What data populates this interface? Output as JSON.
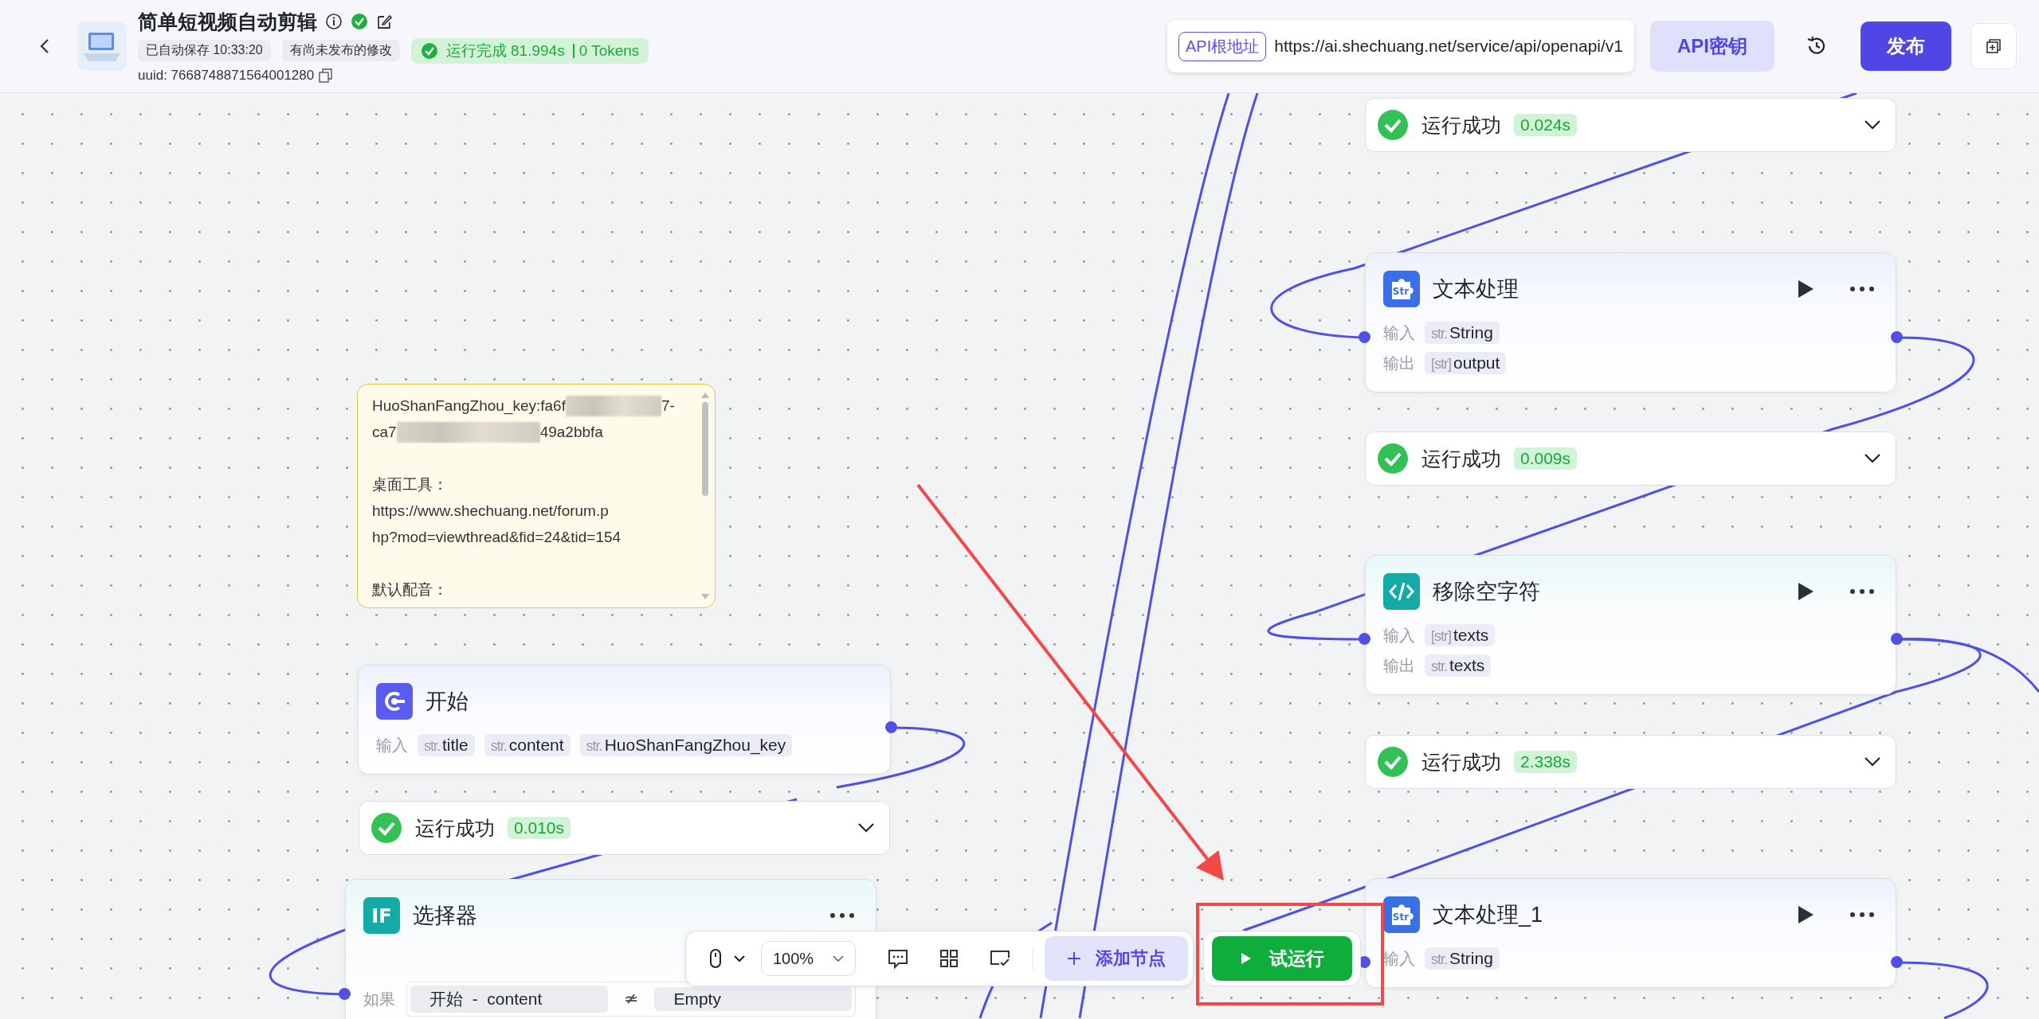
{
  "header": {
    "title": "简单短视频自动剪辑",
    "badges": [
      "已自动保存 10:33:20",
      "有尚未发布的修改"
    ],
    "run_status": {
      "text": "运行完成 81.994s",
      "tokens": "0 Tokens"
    },
    "uuid": "uuid: 7668748871564001280",
    "api_base": {
      "label": "API根地址",
      "url": "https://ai.shechuang.net/service/api/openapi/v1"
    },
    "api_key_button": "API密钥",
    "publish_button": "发布"
  },
  "canvas": {
    "note": {
      "paragraphs": [
        {
          "lines": [
            {
              "parts": [
                {
                  "kind": "text",
                  "text": "HuoShanFangZhou_key:fa6f"
                },
                {
                  "kind": "redacted"
                },
                {
                  "kind": "text",
                  "text": "7-"
                }
              ]
            },
            {
              "parts": [
                {
                  "kind": "text",
                  "text": "ca7"
                },
                {
                  "kind": "redacted"
                },
                {
                  "kind": "text",
                  "text": "49a2bbfa"
                }
              ]
            }
          ]
        },
        {
          "lines": [
            {
              "parts": [
                {
                  "kind": "text",
                  "text": "桌面工具："
                }
              ]
            },
            {
              "parts": [
                {
                  "kind": "text",
                  "text": "https://www.shechuang.net/forum.p"
                }
              ]
            },
            {
              "parts": [
                {
                  "kind": "text",
                  "text": "hp?mod=viewthread&fid=24&tid=154"
                }
              ]
            }
          ]
        },
        {
          "lines": [
            {
              "parts": [
                {
                  "kind": "text",
                  "text": "默认配音："
                }
              ]
            }
          ]
        }
      ]
    },
    "nodes": [
      {
        "kind": "start",
        "title": "开始",
        "rows": [
          {
            "label": "输入",
            "vars": [
              {
                "type": "str.",
                "name": "title"
              },
              {
                "type": "str.",
                "name": "content"
              },
              {
                "type": "str.",
                "name": "HuoShanFangZhou_key"
              }
            ]
          }
        ]
      },
      {
        "kind": "selector",
        "icon_text": "IF",
        "title": "选择器",
        "condition": {
          "label": "如果",
          "left": "开始 - content",
          "operator": "≄",
          "right": "Empty"
        }
      },
      {
        "kind": "text",
        "icon_text": "Str",
        "title": "文本处理",
        "rows": [
          {
            "label": "输入",
            "vars": [
              {
                "type": "str.",
                "name": "String"
              }
            ]
          },
          {
            "label": "输出",
            "vars": [
              {
                "type": "[str]",
                "name": "output"
              }
            ]
          }
        ]
      },
      {
        "kind": "code",
        "title": "移除空字符",
        "rows": [
          {
            "label": "输入",
            "vars": [
              {
                "type": "[str]",
                "name": "texts"
              }
            ]
          },
          {
            "label": "输出",
            "vars": [
              {
                "type": "str.",
                "name": "texts"
              }
            ]
          }
        ]
      },
      {
        "kind": "text",
        "icon_text": "Str",
        "title": "文本处理_1",
        "rows": [
          {
            "label": "输入",
            "vars": [
              {
                "type": "str.",
                "name": "String"
              }
            ]
          }
        ]
      }
    ],
    "run_results": [
      {
        "label": "运行成功",
        "time": "0.010s"
      },
      {
        "label": "运行成功",
        "time": "0.024s"
      },
      {
        "label": "运行成功",
        "time": "0.009s"
      },
      {
        "label": "运行成功",
        "time": "2.338s"
      }
    ],
    "toolbar": {
      "zoom": "100%",
      "add_node": "添加节点",
      "run_button": "试运行"
    },
    "annotations": [
      {
        "kind": "arrow"
      },
      {
        "kind": "frame"
      }
    ]
  }
}
